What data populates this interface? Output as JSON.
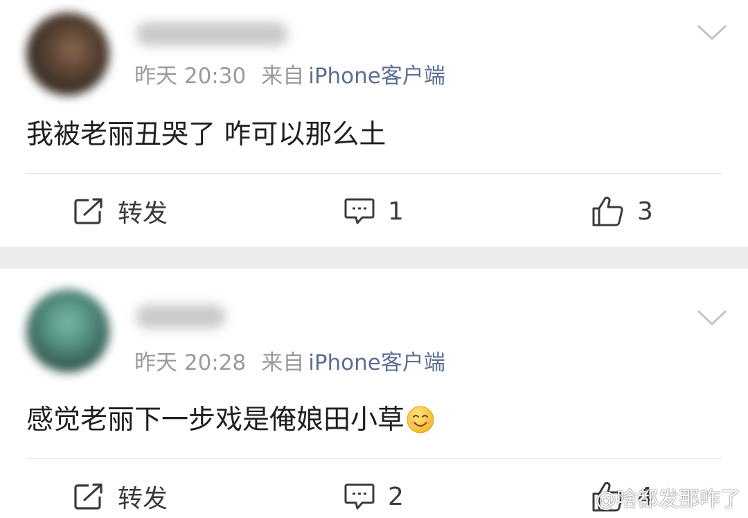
{
  "posts": [
    {
      "time": "昨天 20:30",
      "source_label": "来自",
      "client": "iPhone客户端",
      "text": "我被老丽丑哭了 咋可以那么土",
      "has_emoji": false,
      "repost_label": "转发",
      "comment_count": "1",
      "like_count": "3"
    },
    {
      "time": "昨天 20:28",
      "source_label": "来自",
      "client": "iPhone客户端",
      "text": "感觉老丽下一步戏是俺娘田小草",
      "has_emoji": true,
      "emoji_icon": "smiling-face-emoji",
      "repost_label": "转发",
      "comment_count": "2",
      "like_count": "4"
    }
  ],
  "watermark": "@啥都发那咋了",
  "colors": {
    "client_link": "#5b6f8f",
    "meta_text": "#9a9a9a",
    "separator_band": "#ececec"
  }
}
